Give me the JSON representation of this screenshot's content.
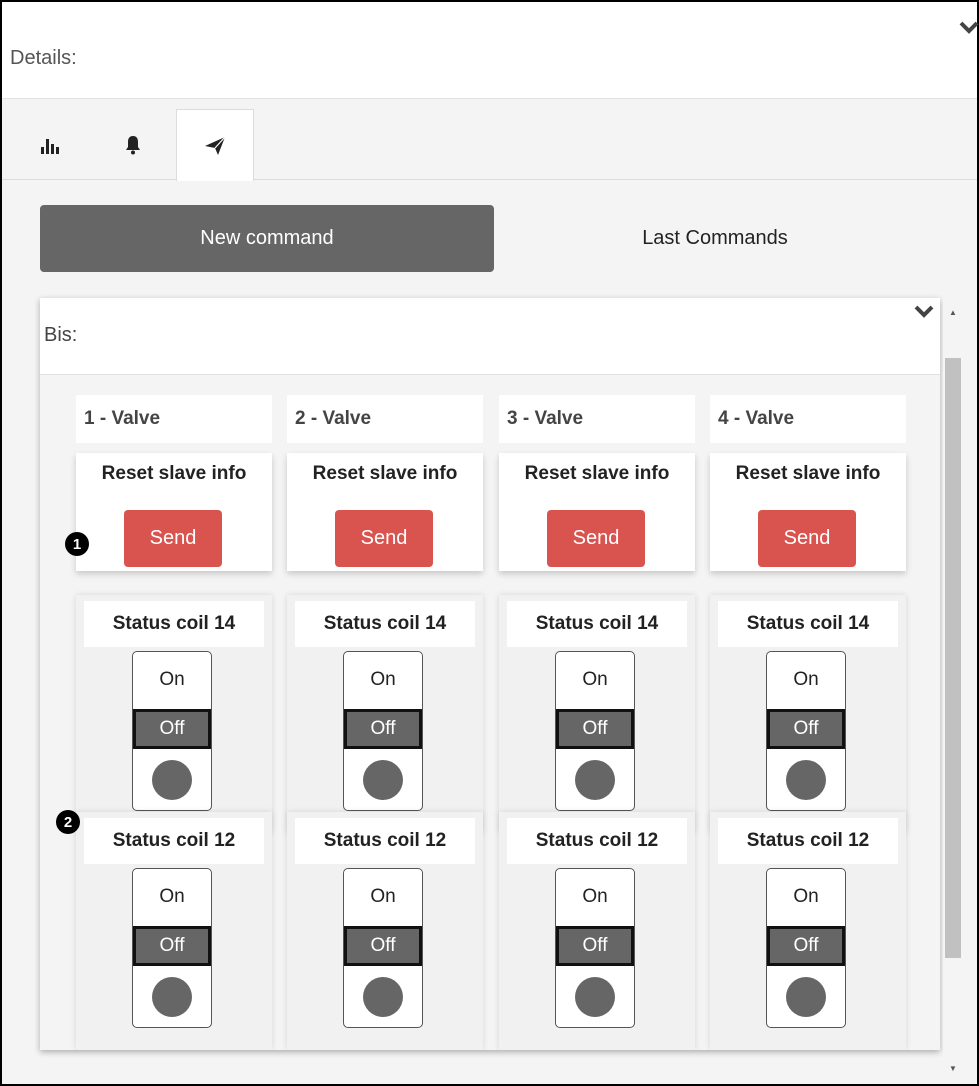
{
  "details": {
    "title": "Details:"
  },
  "tabs": [
    {
      "icon": "bar-chart-icon",
      "active": false
    },
    {
      "icon": "bell-icon",
      "active": false
    },
    {
      "icon": "send-icon",
      "active": true
    }
  ],
  "segments": {
    "new_command": "New command",
    "last_commands": "Last Commands"
  },
  "panel": {
    "title": "Bis:"
  },
  "colors": {
    "send": "#d9534f",
    "active_segment": "#666666",
    "switch_off": "#666666"
  },
  "columns": [
    {
      "title": "1 - Valve",
      "command": "Reset slave info",
      "send_label": "Send",
      "coils": [
        {
          "label": "Status coil 14",
          "on": "On",
          "off": "Off",
          "state": "Off"
        },
        {
          "label": "Status coil 12",
          "on": "On",
          "off": "Off",
          "state": "Off"
        }
      ]
    },
    {
      "title": "2 - Valve",
      "command": "Reset slave info",
      "send_label": "Send",
      "coils": [
        {
          "label": "Status coil 14",
          "on": "On",
          "off": "Off",
          "state": "Off"
        },
        {
          "label": "Status coil 12",
          "on": "On",
          "off": "Off",
          "state": "Off"
        }
      ]
    },
    {
      "title": "3 - Valve",
      "command": "Reset slave info",
      "send_label": "Send",
      "coils": [
        {
          "label": "Status coil 14",
          "on": "On",
          "off": "Off",
          "state": "Off"
        },
        {
          "label": "Status coil 12",
          "on": "On",
          "off": "Off",
          "state": "Off"
        }
      ]
    },
    {
      "title": "4 - Valve",
      "command": "Reset slave info",
      "send_label": "Send",
      "coils": [
        {
          "label": "Status coil 14",
          "on": "On",
          "off": "Off",
          "state": "Off"
        },
        {
          "label": "Status coil 12",
          "on": "On",
          "off": "Off",
          "state": "Off"
        }
      ]
    }
  ],
  "markers": [
    {
      "label": "1"
    },
    {
      "label": "2"
    }
  ]
}
